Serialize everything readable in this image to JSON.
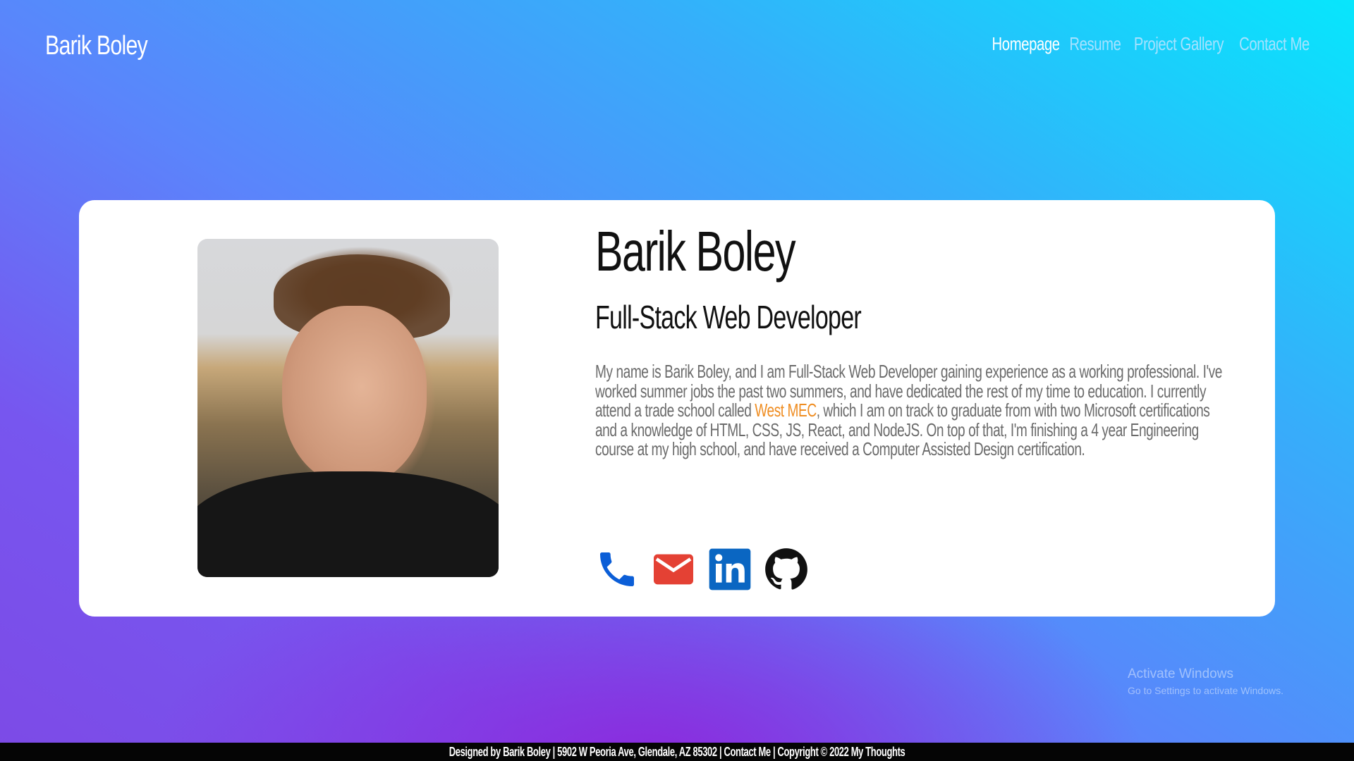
{
  "header": {
    "brand": "Barik Boley",
    "nav": [
      {
        "label": "Homepage",
        "active": true
      },
      {
        "label": "Resume",
        "active": false
      },
      {
        "label": "Project Gallery",
        "active": false
      },
      {
        "label": "Contact Me",
        "active": false
      }
    ]
  },
  "profile": {
    "name": "Barik Boley",
    "title": "Full-Stack Web Developer",
    "bio_before_link": "My name is Barik Boley, and I am Full-Stack Web Developer gaining experience as a working professional. I've worked summer jobs the past two summers, and have dedicated the rest of my time to education. I currently attend a trade school called ",
    "bio_link": "West MEC",
    "bio_after_link": ", which I am on track to graduate from with two Microsoft certifications and a knowledge of HTML, CSS, JS, React, and NodeJS. On top of that, I'm finishing a 4 year Engineering course at my high school, and have received a Computer Assisted Design certification.",
    "photo_icon": "profile-photo",
    "socials": [
      {
        "icon": "phone-icon",
        "color": "#0b5ed7"
      },
      {
        "icon": "email-icon",
        "color": "#e44134"
      },
      {
        "icon": "linkedin-icon",
        "color": "#0a66c2"
      },
      {
        "icon": "github-icon",
        "color": "#111111"
      }
    ]
  },
  "watermark": {
    "title": "Activate Windows",
    "subtitle": "Go to Settings to activate Windows."
  },
  "footer": {
    "text": "Designed by Barik Boley | 5902 W Peoria Ave, Glendale, AZ 85302 | Contact Me | Copyright © 2022 My Thoughts"
  },
  "colors": {
    "gradient_top_right": "#07e6fc",
    "gradient_bottom": "#7d4ae6",
    "link_accent": "#ef8d22",
    "footer_bg": "#050505"
  }
}
